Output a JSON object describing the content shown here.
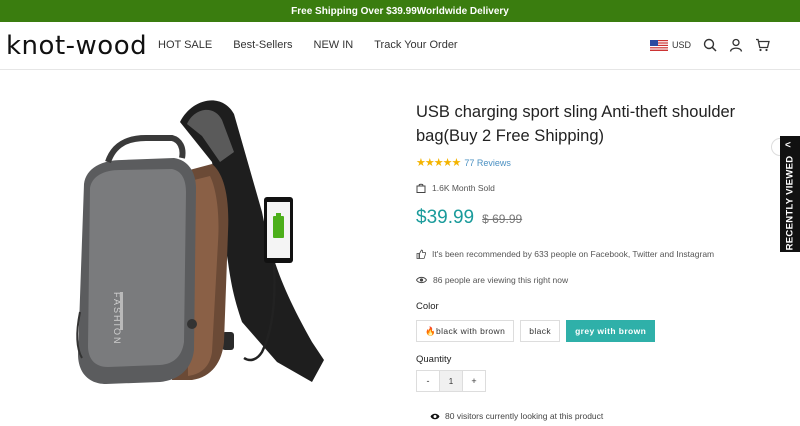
{
  "announcement": "Free Shipping Over $39.99Worldwide Delivery",
  "header": {
    "logo": "knot-wood",
    "nav": [
      "HOT SALE",
      "Best-Sellers",
      "NEW IN",
      "Track Your Order"
    ],
    "currency": "USD",
    "icons": [
      "us-flag-icon",
      "search-icon",
      "account-icon",
      "cart-icon"
    ]
  },
  "product": {
    "title": "USB charging sport sling Anti-theft shoulder bag(Buy 2 Free Shipping)",
    "stars": "★★★★★",
    "rating": 5,
    "reviews": "77 Reviews",
    "sold": "1.6K Month Sold",
    "price": "$39.99",
    "old_price": "$ 69.99",
    "recommended": "It's been recommended by 633 people on Facebook, Twitter and Instagram",
    "viewing": "86 people are viewing this right now",
    "color_label": "Color",
    "variants": [
      "🔥black with brown",
      "black",
      "grey with brown"
    ],
    "selected_variant": "grey with brown",
    "quantity_label": "Quantity",
    "quantity": "1",
    "qty_minus": "-",
    "qty_plus": "+",
    "visitors": "80 visitors currently looking at this product",
    "image_text": "FASHION"
  },
  "side_tab": {
    "label": "RECENTLY VIEWED",
    "chevron": "<"
  },
  "colors": {
    "announcement_bg": "#3a7d0f",
    "price": "#1a9b9b",
    "selected_variant": "#2fb0a9",
    "stars": "#f4b400"
  }
}
